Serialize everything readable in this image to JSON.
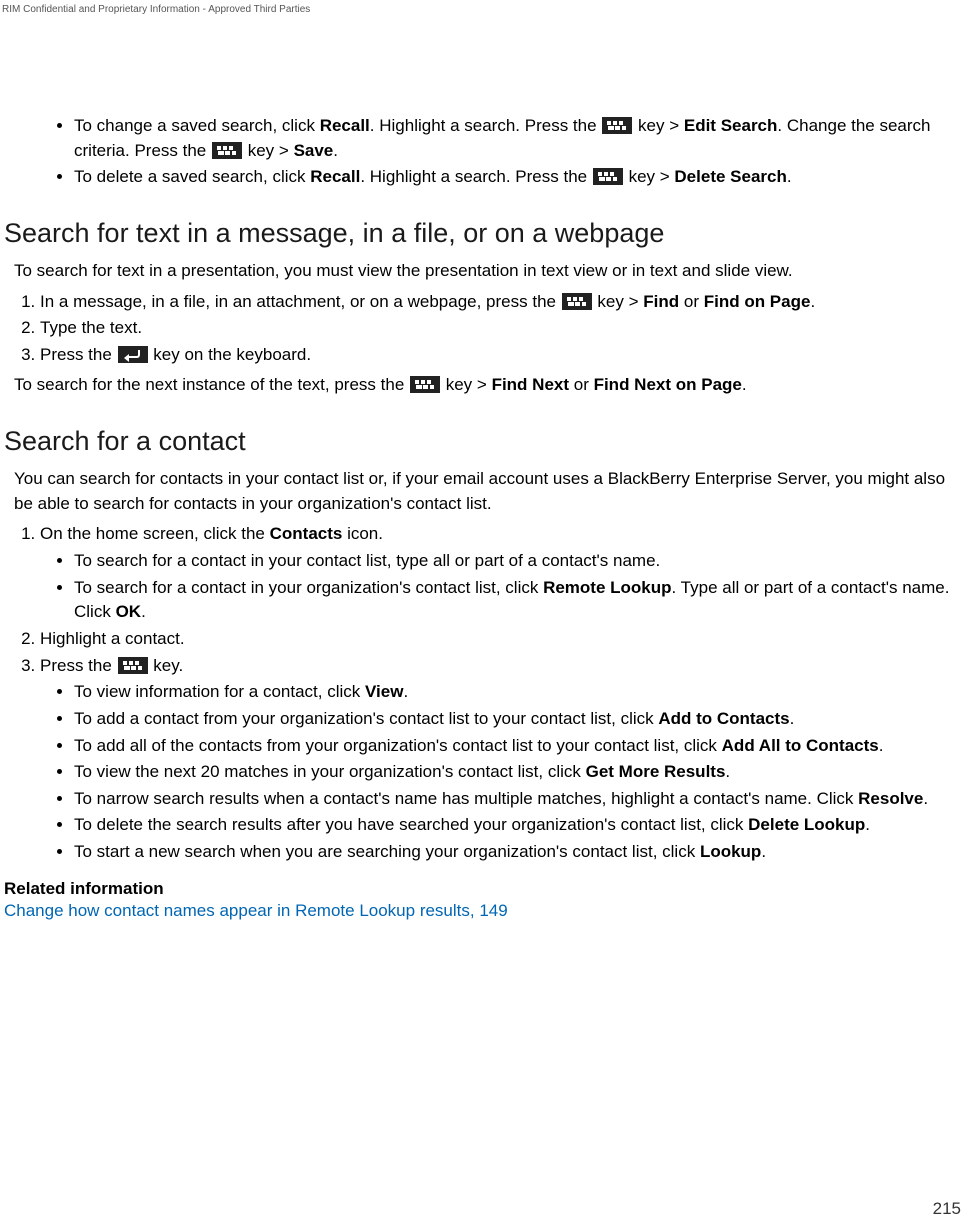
{
  "header": {
    "confidential": "RIM Confidential and Proprietary Information - Approved Third Parties"
  },
  "footer": {
    "page": "215"
  },
  "intro_bullets": [
    {
      "pre": "To change a saved search, click ",
      "b1": "Recall",
      "mid1": ". Highlight a search. Press the ",
      "mid2": " key > ",
      "b2": "Edit Search",
      "mid3": ". Change the search criteria. Press the ",
      "mid4": " key > ",
      "b3": "Save",
      "post": "."
    },
    {
      "pre": "To delete a saved search, click ",
      "b1": "Recall",
      "mid1": ". Highlight a search. Press the ",
      "mid2": " key > ",
      "b2": "Delete Search",
      "post": "."
    }
  ],
  "section1": {
    "title": "Search for text in a message, in a file, or on a webpage",
    "intro": "To search for text in a presentation, you must view the presentation in text view or in text and slide view.",
    "steps": {
      "s1_pre": "In a message, in a file, in an attachment, or on a webpage, press the ",
      "s1_mid": " key > ",
      "s1_b1": "Find",
      "s1_or": " or ",
      "s1_b2": "Find on Page",
      "s1_post": ".",
      "s2": "Type the text.",
      "s3_pre": "Press the ",
      "s3_post": " key on the keyboard."
    },
    "outro_pre": "To search for the next instance of the text, press the ",
    "outro_mid": " key > ",
    "outro_b1": "Find Next",
    "outro_or": " or ",
    "outro_b2": "Find Next on Page",
    "outro_post": "."
  },
  "section2": {
    "title": "Search for a contact",
    "intro": "You can search for contacts in your contact list or, if your email account uses a BlackBerry Enterprise Server, you might also be able to search for contacts in your organization's contact list.",
    "step1_pre": "On the home screen, click the ",
    "step1_b": "Contacts",
    "step1_post": " icon.",
    "step1_bullets": [
      {
        "text": "To search for a contact in your contact list, type all or part of a contact's name."
      },
      {
        "pre": "To search for a contact in your organization's contact list, click ",
        "b1": "Remote Lookup",
        "mid": ". Type all or part of a contact's name. Click ",
        "b2": "OK",
        "post": "."
      }
    ],
    "step2": "Highlight a contact.",
    "step3_pre": "Press the ",
    "step3_post": " key.",
    "step3_bullets": [
      {
        "pre": "To view information for a contact, click ",
        "b": "View",
        "post": "."
      },
      {
        "pre": "To add a contact from your organization's contact list to your contact list, click ",
        "b": "Add to Contacts",
        "post": "."
      },
      {
        "pre": "To add all of the contacts from your organization's contact list to your contact list, click ",
        "b": "Add All to Contacts",
        "post": "."
      },
      {
        "pre": "To view the next 20 matches in your organization's contact list, click ",
        "b": "Get More Results",
        "post": "."
      },
      {
        "pre": "To narrow search results when a contact's name has multiple matches, highlight a contact's name. Click ",
        "b": "Resolve",
        "post": "."
      },
      {
        "pre": "To delete the search results after you have searched your organization's contact list, click ",
        "b": "Delete Lookup",
        "post": "."
      },
      {
        "pre": "To start a new search when you are searching your organization's contact list, click ",
        "b": "Lookup",
        "post": "."
      }
    ]
  },
  "related": {
    "heading": "Related information",
    "link": "Change how contact names appear in Remote Lookup results, 149"
  }
}
